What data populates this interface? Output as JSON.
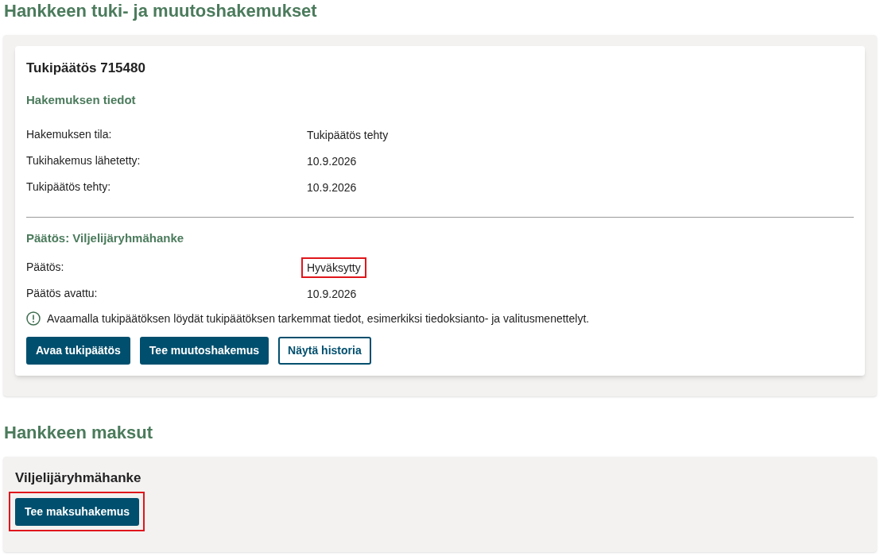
{
  "support_section": {
    "title": "Hankkeen tuki- ja muutoshakemukset",
    "card": {
      "title": "Tukipäätös 715480",
      "application": {
        "heading": "Hakemuksen tiedot",
        "rows": [
          {
            "label": "Hakemuksen tila:",
            "value": "Tukipäätös tehty",
            "highlighted": false
          },
          {
            "label": "Tukihakemus lähetetty:",
            "value": "10.9.2026",
            "highlighted": false
          },
          {
            "label": "Tukipäätös tehty:",
            "value": "10.9.2026",
            "highlighted": false
          }
        ]
      },
      "decision": {
        "heading": "Päätös: Viljelijäryhmähanke",
        "rows": [
          {
            "label": "Päätös:",
            "value": "Hyväksytty",
            "highlighted": true
          },
          {
            "label": "Päätös avattu:",
            "value": "10.9.2026",
            "highlighted": false
          }
        ],
        "info": "Avaamalla tukipäätöksen löydät tukipäätöksen tarkemmat tiedot, esimerkiksi tiedoksianto- ja valitusmenettelyt.",
        "buttons": [
          {
            "label": "Avaa tukipäätös",
            "kind": "primary",
            "highlighted": false
          },
          {
            "label": "Tee muutoshakemus",
            "kind": "primary",
            "highlighted": false
          },
          {
            "label": "Näytä historia",
            "kind": "secondary",
            "highlighted": false
          }
        ]
      }
    }
  },
  "payments_section": {
    "title": "Hankkeen maksut",
    "panel": {
      "title": "Viljelijäryhmähanke",
      "buttons": [
        {
          "label": "Tee maksuhakemus",
          "kind": "primary",
          "highlighted": true
        }
      ]
    }
  }
}
